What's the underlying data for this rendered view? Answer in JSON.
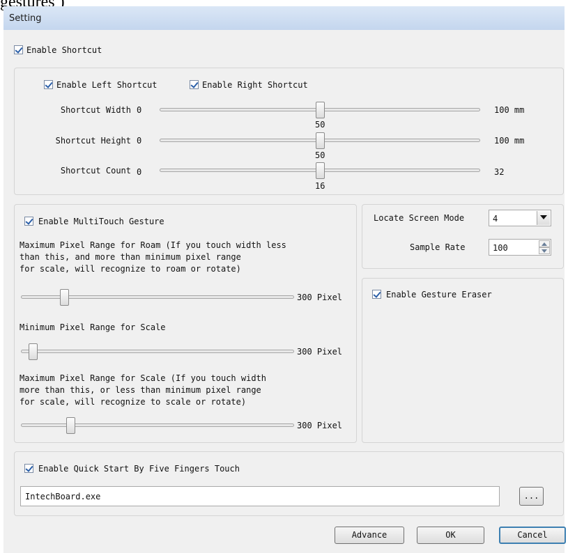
{
  "caption_fragment": "gestures )",
  "window": {
    "title": "Setting"
  },
  "shortcut": {
    "enable_label": "Enable Shortcut",
    "enable_checked": true,
    "left_label": "Enable Left Shortcut",
    "right_label": "Enable Right Shortcut",
    "sliders": [
      {
        "label": "Shortcut Width",
        "min": "0",
        "max": "100 mm",
        "value": "50",
        "fraction": 0.5
      },
      {
        "label": "Shortcut Height",
        "min": "0",
        "max": "100 mm",
        "value": "50",
        "fraction": 0.5
      },
      {
        "label": "Shortcut Count",
        "min": "0",
        "max": "32",
        "value": "16",
        "fraction": 0.5
      }
    ]
  },
  "multitouch": {
    "enable_label": "Enable MultiTouch Gesture",
    "roam_desc": [
      "Maximum Pixel Range for Roam (If you touch width less",
      "than this, and more than minimum pixel range",
      "for scale, will recognize to roam or rotate)"
    ],
    "roam_max": "300 Pixel",
    "roam_fraction": 0.16,
    "scale_min_label": "Minimum Pixel Range for Scale",
    "scale_min_max": "300 Pixel",
    "scale_min_fraction": 0.04,
    "scale_max_desc": [
      "Maximum Pixel Range for Scale (If you touch width",
      "more than this, or less than minimum pixel range",
      "for scale, will recognize to scale or rotate)"
    ],
    "scale_max_max": "300 Pixel",
    "scale_max_fraction": 0.18
  },
  "screen": {
    "mode_label": "Locate Screen Mode",
    "mode_value": "4",
    "sample_label": "Sample Rate",
    "sample_value": "100"
  },
  "eraser": {
    "enable_label": "Enable Gesture Eraser"
  },
  "quickstart": {
    "enable_label": "Enable Quick Start By Five Fingers Touch",
    "path": "IntechBoard.exe",
    "browse_label": "..."
  },
  "buttons": {
    "advance": "Advance",
    "ok": "OK",
    "cancel": "Cancel"
  },
  "colors": {
    "title_bar": "#c4d6ee",
    "check_mark": "#2b5fa8",
    "default_button_border": "#3c7fb1"
  }
}
